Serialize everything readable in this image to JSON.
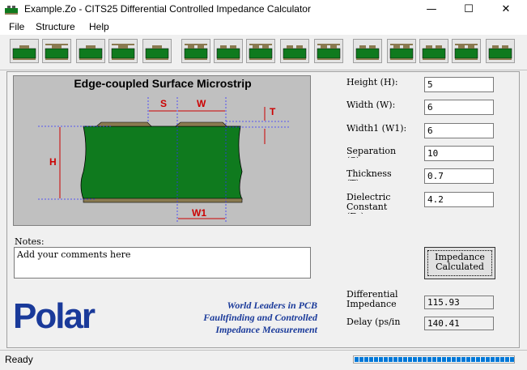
{
  "window": {
    "title": "Example.Zo - CITS25 Differential Controlled Impedance Calculator",
    "minimize": "—",
    "maximize": "☐",
    "close": "✕"
  },
  "menu": {
    "file": "File",
    "structure": "Structure",
    "help": "Help"
  },
  "toolbar": {
    "buttons": [
      "structure-1",
      "structure-2",
      "structure-3",
      "structure-4",
      "structure-5",
      "structure-6",
      "structure-7",
      "structure-8",
      "structure-9",
      "structure-10",
      "structure-11",
      "structure-12",
      "structure-13",
      "structure-14",
      "structure-15"
    ]
  },
  "diagram": {
    "title": "Edge-coupled Surface Microstrip",
    "labels": {
      "s": "S",
      "w": "W",
      "t": "T",
      "h": "H",
      "w1": "W1"
    }
  },
  "params": {
    "height": {
      "label": "Height (H):",
      "value": "5"
    },
    "width": {
      "label": "Width (W):",
      "value": "6"
    },
    "width1": {
      "label": "Width1 (W1):",
      "value": "6"
    },
    "separation": {
      "label": "Separation (S):",
      "value": "10"
    },
    "thickness": {
      "label": "Thickness (T):",
      "value": "0.7"
    },
    "dielectric": {
      "label": "Dielectric Constant (Er):",
      "value": "4.2"
    }
  },
  "notes": {
    "label": "Notes:",
    "value": "Add your comments here"
  },
  "calculate": {
    "line1": "Impedance",
    "line2": "Calculated"
  },
  "results": {
    "impedance": {
      "label1": "Differential",
      "label2": "Impedance",
      "value": "115.93"
    },
    "delay": {
      "label": "Delay (ps/in",
      "value": "140.41"
    }
  },
  "branding": {
    "logo": "Polar",
    "slogan1": "World Leaders in PCB",
    "slogan2": "Faultfinding and Controlled",
    "slogan3": "Impedance Measurement"
  },
  "status": {
    "text": "Ready",
    "progress": 1.0
  },
  "colors": {
    "substrate": "#0f7a1e",
    "copper": "#8a7a50",
    "dim": "#cc0000",
    "logo": "#1a3a9a"
  }
}
